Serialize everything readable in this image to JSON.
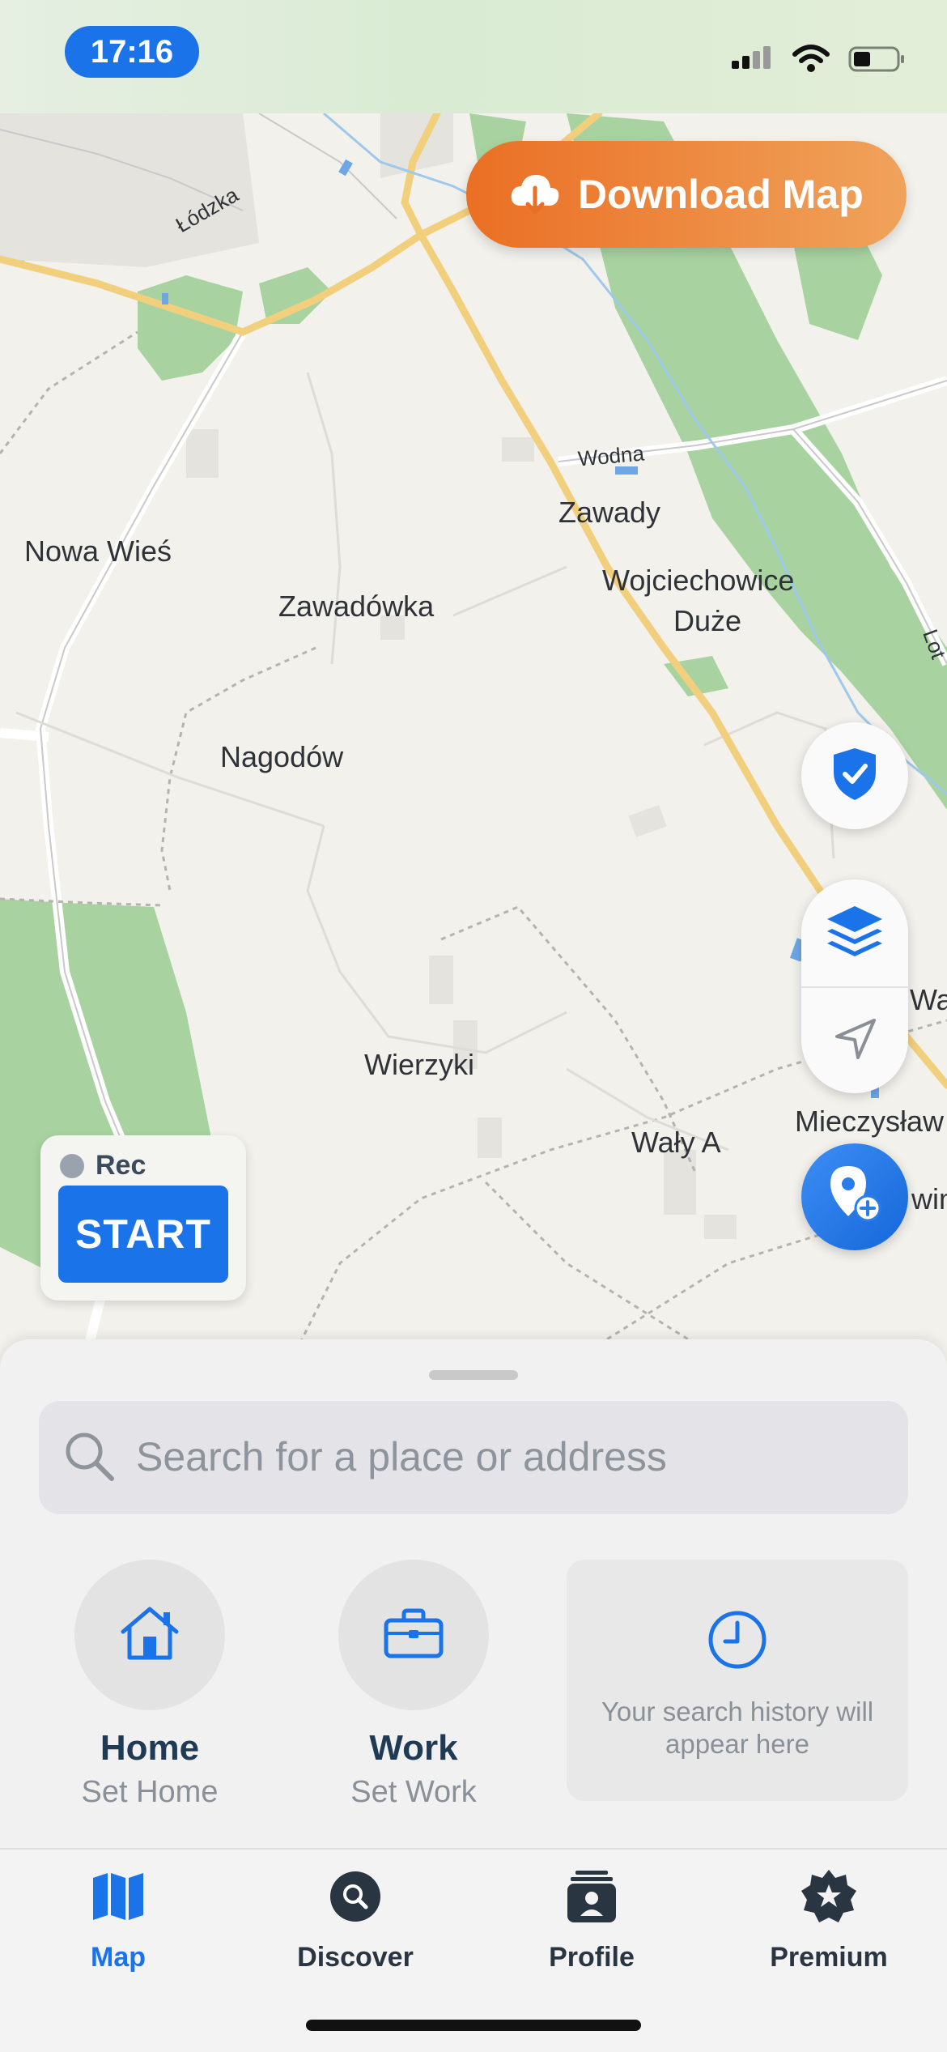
{
  "status": {
    "time": "17:16"
  },
  "download_button": {
    "label": "Download Map",
    "icon": "cloud-download-icon"
  },
  "map": {
    "place_labels": [
      "Nowa Wieś",
      "Zawadówka",
      "Zawady",
      "Wojciechowice",
      "Duże",
      "Nagodów",
      "Wierzyki",
      "Wały A",
      "Mieczysław",
      "Wa",
      "win"
    ],
    "road_labels": [
      "Łódzka",
      "Wodna",
      "Lot"
    ]
  },
  "recorder": {
    "status_label": "Rec",
    "start_label": "START"
  },
  "map_controls": {
    "shield": "shield-check-icon",
    "layers": "layers-icon",
    "locate": "navigation-arrow-icon",
    "add_place": "add-place-icon"
  },
  "search": {
    "placeholder": "Search for a place or address"
  },
  "shortcuts": [
    {
      "title": "Home",
      "subtitle": "Set Home",
      "icon": "house-icon"
    },
    {
      "title": "Work",
      "subtitle": "Set Work",
      "icon": "briefcase-icon"
    }
  ],
  "history": {
    "message": "Your search history will appear here",
    "icon": "clock-icon"
  },
  "tabs": [
    {
      "label": "Map",
      "icon": "map-icon",
      "active": true
    },
    {
      "label": "Discover",
      "icon": "discover-search-icon",
      "active": false
    },
    {
      "label": "Profile",
      "icon": "profile-icon",
      "active": false
    },
    {
      "label": "Premium",
      "icon": "premium-star-icon",
      "active": false
    }
  ],
  "colors": {
    "accent": "#1a73e8",
    "download_start": "#ea6f24",
    "download_end": "#f0a35b",
    "forest": "#a8d3a0",
    "major_road": "#f1cf7c"
  }
}
